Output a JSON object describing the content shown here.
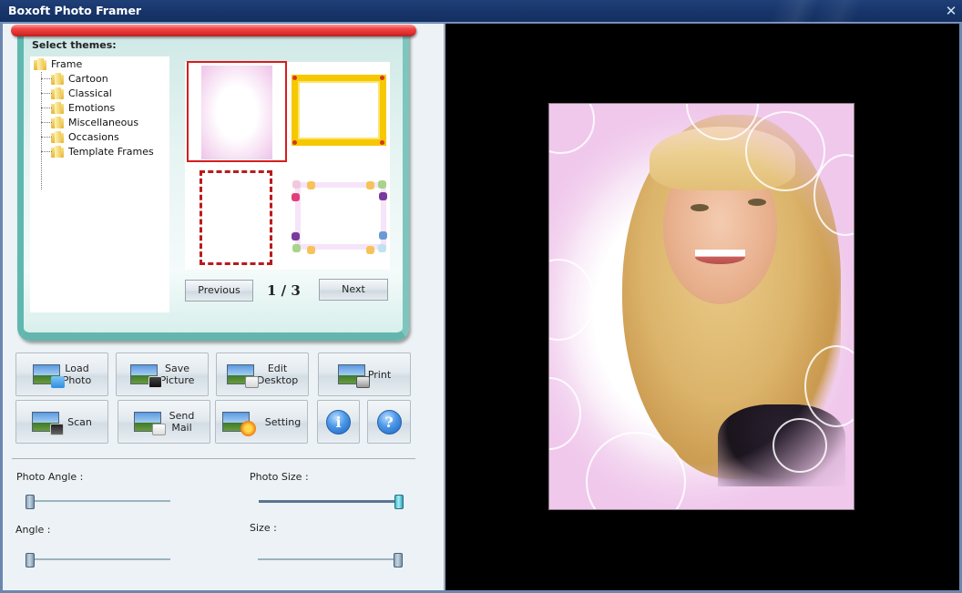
{
  "window": {
    "title": "Boxoft Photo Framer",
    "close_label": "✕"
  },
  "themes": {
    "heading": "Select themes:",
    "tree": {
      "root": "Frame",
      "children": [
        "Cartoon",
        "Classical",
        "Emotions",
        "Miscellaneous",
        "Occasions",
        "Template Frames"
      ]
    },
    "thumbnails": [
      {
        "name": "pink-floral-frame",
        "selected": true
      },
      {
        "name": "yellow-wavy-frame",
        "selected": false
      },
      {
        "name": "red-dashed-frame",
        "selected": false
      },
      {
        "name": "flower-corner-frame",
        "selected": false
      }
    ],
    "pagination": {
      "previous_label": "Previous",
      "next_label": "Next",
      "current_page": 1,
      "total_pages": 3,
      "indicator": "1 / 3"
    }
  },
  "actions": {
    "load_photo": "Load\nPhoto",
    "load_photo_l1": "Load",
    "load_photo_l2": "Photo",
    "save_picture_l1": "Save",
    "save_picture_l2": "Picture",
    "edit_desktop_l1": "Edit",
    "edit_desktop_l2": "Desktop",
    "print": "Print",
    "scan": "Scan",
    "send_mail_l1": "Send",
    "send_mail_l2": "Mail",
    "setting": "Setting",
    "info_glyph": "i",
    "help_glyph": "?"
  },
  "sliders": {
    "photo_angle": {
      "label": "Photo Angle :",
      "value_fraction": 0.0
    },
    "photo_size": {
      "label": "Photo Size :",
      "value_fraction": 1.0
    },
    "angle": {
      "label": "Angle :",
      "value_fraction": 0.0
    },
    "size": {
      "label": "Size :",
      "value_fraction": 1.0
    }
  },
  "colors": {
    "titlebar": "#173468",
    "accent_red": "#e03030",
    "teal_frame": "#5fb8b0",
    "selection_outline": "#d51e1e",
    "preview_background": "#000000"
  }
}
